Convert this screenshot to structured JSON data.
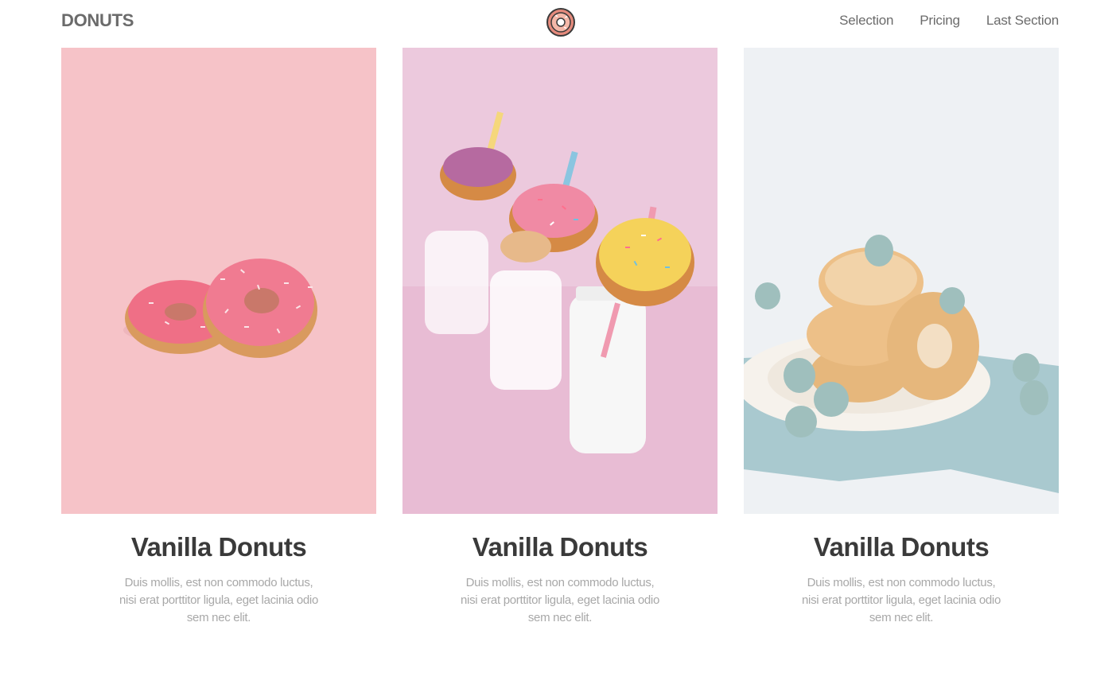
{
  "header": {
    "brand": "DONUTS",
    "logo_icon": "donut-logo-icon",
    "nav": [
      "Selection",
      "Pricing",
      "Last Section"
    ]
  },
  "cards": [
    {
      "title": "Vanilla Donuts",
      "text": "Duis mollis, est non commodo luctus, nisi erat porttitor ligula, eget lacinia odio sem nec elit.",
      "image": "pink-donuts-photo",
      "bg": "#f6c3c8"
    },
    {
      "title": "Vanilla Donuts",
      "text": "Duis mollis, est non commodo luctus, nisi erat porttitor ligula, eget lacinia odio sem nec elit.",
      "image": "donuts-on-milk-bottles-photo",
      "bg": "#ecc9dd"
    },
    {
      "title": "Vanilla Donuts",
      "text": "Duis mollis, est non commodo luctus, nisi erat porttitor ligula, eget lacinia odio sem nec elit.",
      "image": "stacked-donuts-plate-photo",
      "bg": "#eef1f4"
    }
  ],
  "colors": {
    "heading": "#3a3a3a",
    "body_text": "#a8a8a8",
    "nav_text": "#6b6b6b",
    "logo_ring": "#e58a7c"
  }
}
